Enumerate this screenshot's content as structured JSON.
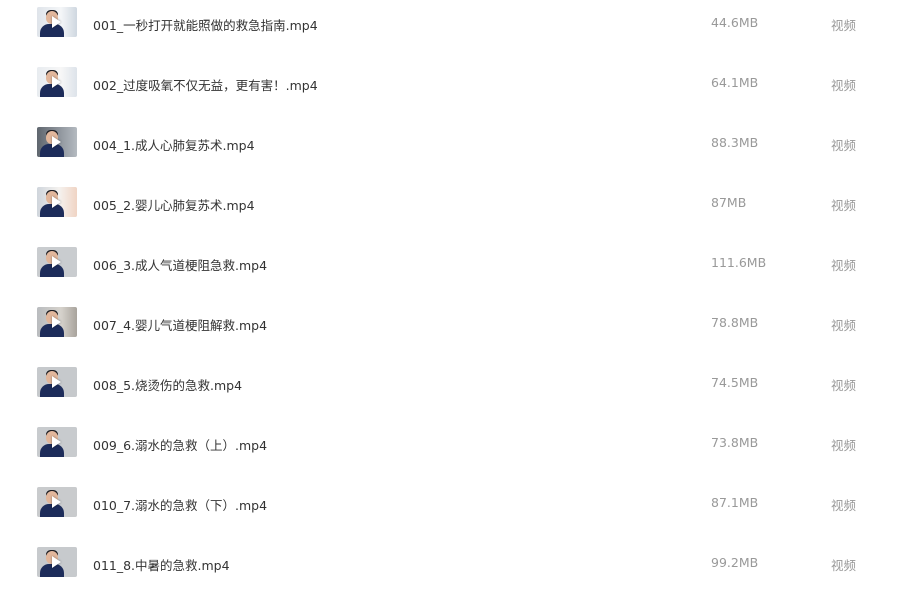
{
  "files": [
    {
      "name": "001_一秒打开就能照做的救急指南.mp4",
      "size": "44.6MB",
      "type": "视频",
      "thumb": "whiteboard"
    },
    {
      "name": "002_过度吸氧不仅无益，更有害！.mp4",
      "size": "64.1MB",
      "type": "视频",
      "thumb": "whiteboard"
    },
    {
      "name": "004_1.成人心肺复苏术.mp4",
      "size": "88.3MB",
      "type": "视频",
      "thumb": "dark"
    },
    {
      "name": "005_2.婴儿心肺复苏术.mp4",
      "size": "87MB",
      "type": "视频",
      "thumb": "whiteboard"
    },
    {
      "name": "006_3.成人气道梗阻急救.mp4",
      "size": "111.6MB",
      "type": "视频",
      "thumb": "grey"
    },
    {
      "name": "007_4.婴儿气道梗阻解救.mp4",
      "size": "78.8MB",
      "type": "视频",
      "thumb": "grey"
    },
    {
      "name": "008_5.烧烫伤的急救.mp4",
      "size": "74.5MB",
      "type": "视频",
      "thumb": "grey"
    },
    {
      "name": "009_6.溺水的急救（上）.mp4",
      "size": "73.8MB",
      "type": "视频",
      "thumb": "grey"
    },
    {
      "name": "010_7.溺水的急救（下）.mp4",
      "size": "87.1MB",
      "type": "视频",
      "thumb": "grey"
    },
    {
      "name": "011_8.中暑的急救.mp4",
      "size": "99.2MB",
      "type": "视频",
      "thumb": "grey"
    }
  ],
  "icons": {
    "thumbnail_overlay": "play-icon"
  },
  "colors": {
    "name_text": "#333333",
    "meta_text": "#999999",
    "background": "#ffffff"
  }
}
